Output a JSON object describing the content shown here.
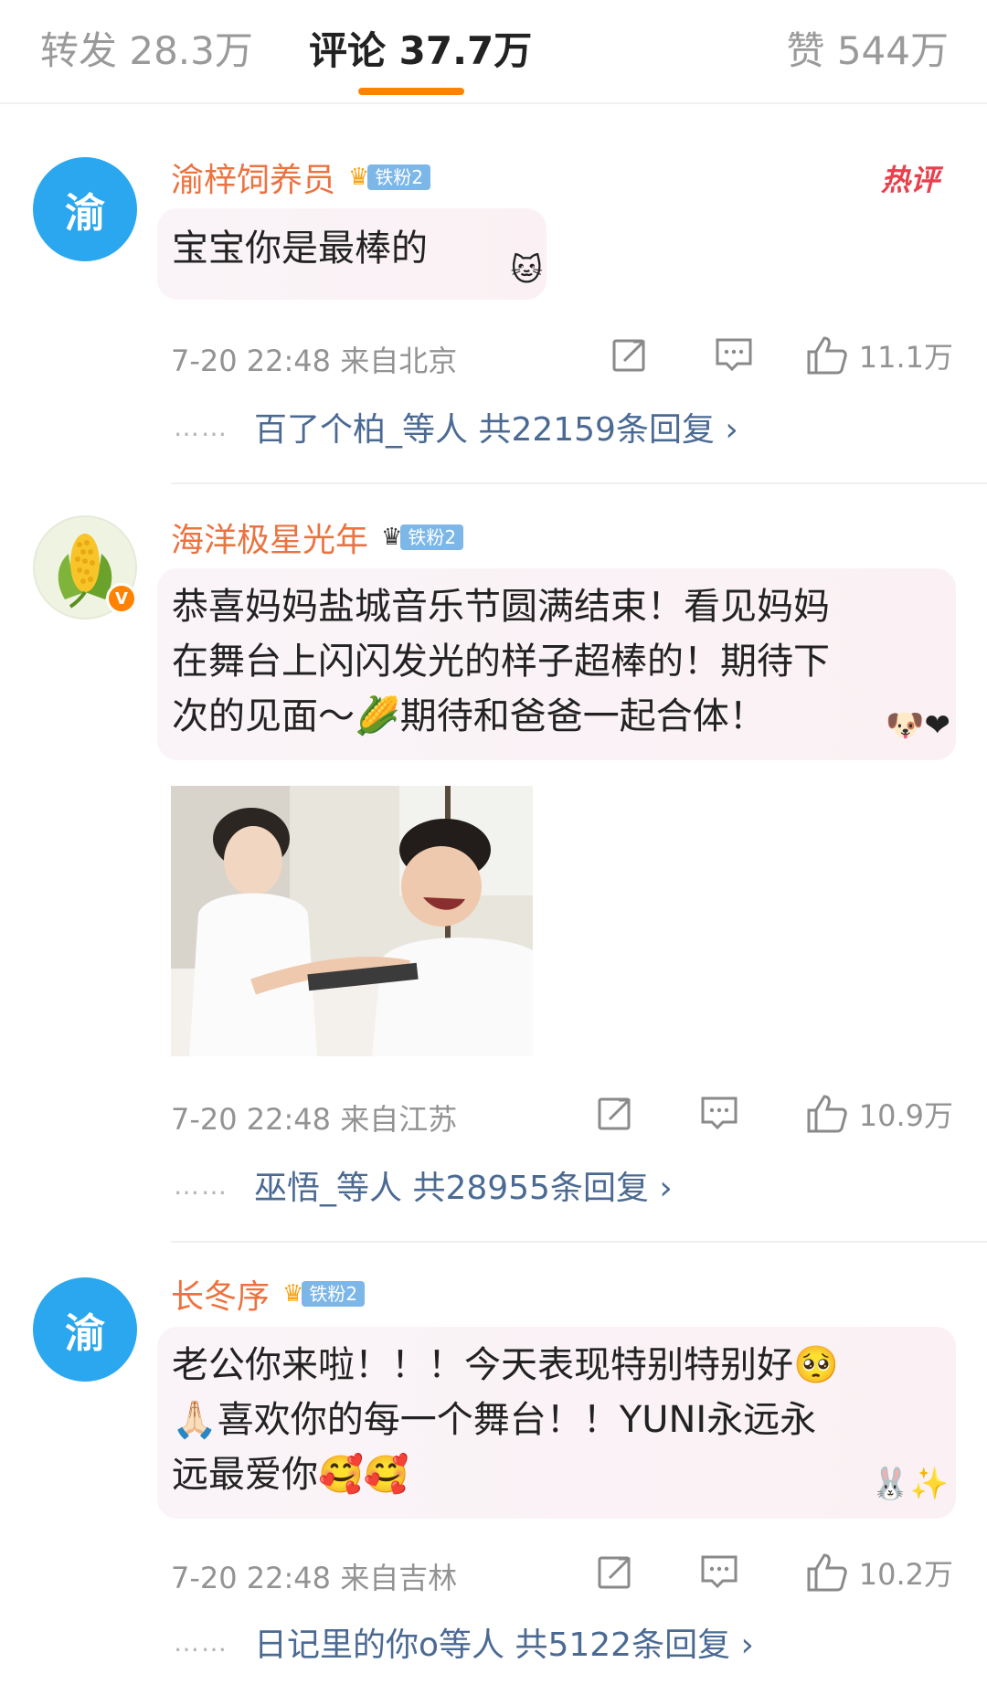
{
  "tabs": {
    "repost": "转发 28.3万",
    "comments": "评论 37.7万",
    "likes": "赞 544万"
  },
  "colors": {
    "accent": "#ff8200",
    "username": "#eb7340",
    "reply_link": "#4b6a93",
    "hot": "#e8414d"
  },
  "comments": [
    {
      "avatar_text": "渝",
      "username": "渝梓饲养员",
      "badge": "铁粉2",
      "hot_tag": "热评",
      "text": "宝宝你是最棒的",
      "meta": "7-20 22:48  来自北京",
      "likes": "11.1万",
      "reply_dots": "……",
      "reply_summary": "百了个柏_等人  共22159条回复 ›"
    },
    {
      "avatar_icon": "corn-icon",
      "username": "海洋极星光年",
      "badge": "铁粉2",
      "text_lines": [
        "恭喜妈妈盐城音乐节圆满结束！看见妈妈",
        "在舞台上闪闪发光的样子超棒的！期待下",
        "次的见面～🌽期待和爸爸一起合体！"
      ],
      "meta": "7-20 22:48  来自江苏",
      "likes": "10.9万",
      "reply_dots": "……",
      "reply_summary": "巫悟_等人  共28955条回复 ›"
    },
    {
      "avatar_text": "渝",
      "username": "长冬序",
      "badge": "铁粉2",
      "text_lines": [
        "老公你来啦！！！今天表现特别特别好🥺",
        "🙏🏻喜欢你的每一个舞台！！YUNI永远永",
        "远最爱你🥰🥰"
      ],
      "meta": "7-20 22:48  来自吉林",
      "likes": "10.2万",
      "reply_dots": "……",
      "reply_summary": "日记里的你o等人  共5122条回复 ›"
    }
  ]
}
